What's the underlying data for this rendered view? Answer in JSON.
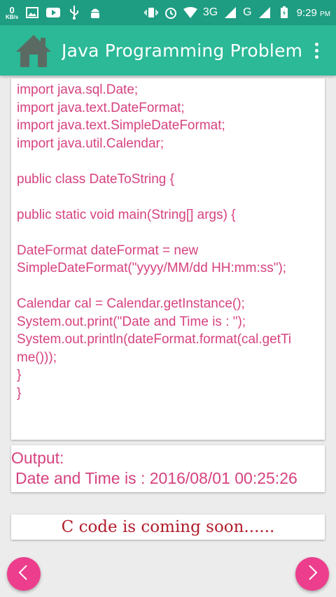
{
  "status_bar": {
    "speed_value": "0",
    "speed_unit": "KB/s",
    "network": "3G",
    "network2": "G",
    "time": "9:29",
    "ampm": "PM"
  },
  "app_bar": {
    "title": "Java Programming Problem",
    "icon": "home-icon"
  },
  "code_lines": [
    "import java.sql.Date;",
    "import java.text.DateFormat;",
    "import java.text.SimpleDateFormat;",
    "import java.util.Calendar;",
    "",
    "public class DateToString {",
    "",
    "public static void main(String[] args) {",
    "",
    "DateFormat dateFormat = new",
    "SimpleDateFormat(\"yyyy/MM/dd HH:mm:ss\");",
    "",
    "Calendar cal = Calendar.getInstance();",
    "System.out.print(\"Date and Time is : \");",
    "System.out.println(dateFormat.format(cal.getTi",
    "me()));",
    "}",
    "}"
  ],
  "output": {
    "label": "Output:",
    "value": "Date and Time is : 2016/08/01 00:25:26"
  },
  "coming_soon": "C code is coming soon......",
  "colors": {
    "status_bar": "#1e9d82",
    "app_bar": "#2bb997",
    "code_text": "#d6427f",
    "soon_text": "#b11d2c",
    "nav_button": "#ec3e8d"
  }
}
